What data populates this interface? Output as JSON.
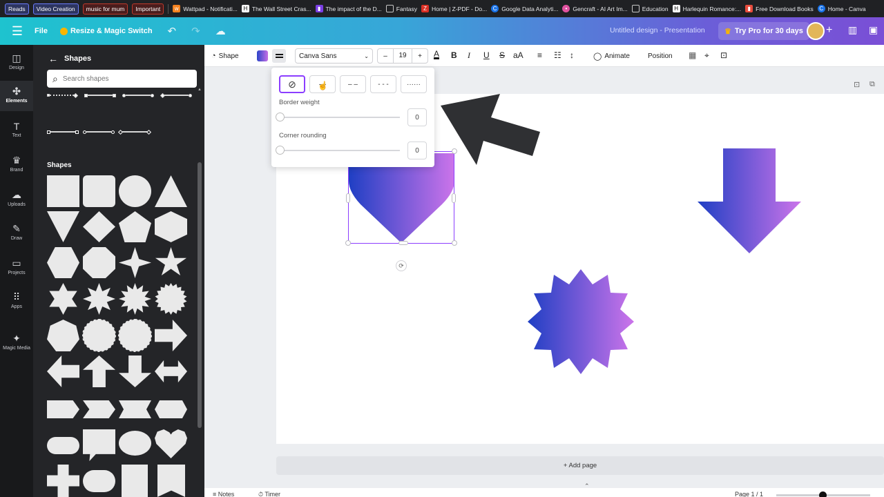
{
  "bookmarks": {
    "tags": [
      "Reads",
      "Video Creation",
      "music for mum",
      "Important"
    ],
    "items": [
      {
        "label": "Wattpad - Notificati...",
        "icon": "wattpad-icon",
        "color": "#f5821f"
      },
      {
        "label": "The Wall Street Cras...",
        "icon": "h-icon",
        "color": "#333333"
      },
      {
        "label": "The impact of the D...",
        "icon": "book-icon",
        "color": "#7b3fe4"
      },
      {
        "label": "Fantasy",
        "icon": "folder-icon",
        "color": "#5f6368"
      },
      {
        "label": "Home | Z-PDF - Do...",
        "icon": "z-icon",
        "color": "#d93025"
      },
      {
        "label": "Google Data Analyti...",
        "icon": "coursera-icon",
        "color": "#1a73e8"
      },
      {
        "label": "Gencraft - AI Art Im...",
        "icon": "gencraft-icon",
        "color": "#e052a0"
      },
      {
        "label": "Education",
        "icon": "folder-icon",
        "color": "#5f6368"
      },
      {
        "label": "Harlequin Romance:...",
        "icon": "harlequin-icon",
        "color": "#555555"
      },
      {
        "label": "Free Download Books",
        "icon": "book-icon",
        "color": "#e84c3d"
      },
      {
        "label": "Home - Canva",
        "icon": "canva-icon",
        "color": "#1a73e8"
      }
    ]
  },
  "topbar": {
    "file": "File",
    "resize": "Resize & Magic Switch",
    "title": "Untitled design - Presentation",
    "trypro": "Try Pro for 30 days"
  },
  "rail": {
    "items": [
      {
        "label": "Design",
        "icon": "layout-icon",
        "glyph": "◫"
      },
      {
        "label": "Elements",
        "icon": "shapes-icon",
        "glyph": "✣"
      },
      {
        "label": "Text",
        "icon": "text-icon",
        "glyph": "T"
      },
      {
        "label": "Brand",
        "icon": "brand-icon",
        "glyph": "♛"
      },
      {
        "label": "Uploads",
        "icon": "cloud-upload-icon",
        "glyph": "☁"
      },
      {
        "label": "Draw",
        "icon": "pen-icon",
        "glyph": "✎"
      },
      {
        "label": "Projects",
        "icon": "folder-icon",
        "glyph": "▭"
      },
      {
        "label": "Apps",
        "icon": "apps-grid-icon",
        "glyph": "⠿"
      },
      {
        "label": "Magic Media",
        "icon": "magic-media-icon",
        "glyph": "✦"
      }
    ]
  },
  "panel": {
    "title": "Shapes",
    "search_placeholder": "Search shapes",
    "section": "Shapes"
  },
  "toolbar": {
    "shape": "Shape",
    "font": "Canva Sans",
    "font_size": "19",
    "animate": "Animate",
    "position": "Position"
  },
  "popup": {
    "border_weight_label": "Border weight",
    "border_weight_value": "0",
    "corner_rounding_label": "Corner rounding",
    "corner_rounding_value": "0"
  },
  "canvas": {
    "add_page": "+ Add page"
  },
  "footer": {
    "notes": "Notes",
    "timer": "Timer",
    "page": "Page 1 / 1"
  },
  "colors": {
    "accent": "#8b3dff",
    "gradient_start": "#1f3fc4",
    "gradient_end": "#cc74ea"
  }
}
